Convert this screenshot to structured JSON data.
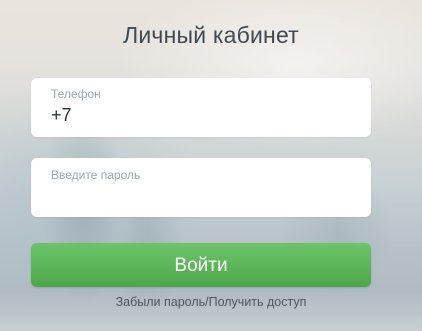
{
  "page": {
    "title": "Личный кабинет"
  },
  "phone_field": {
    "label": "Телефон",
    "value": "+7"
  },
  "password_field": {
    "placeholder": "Введите пароль",
    "value": ""
  },
  "login_button": {
    "label": "Войти",
    "color": "#5bb557"
  },
  "forgot_link": {
    "label": "Забыли пароль/Получить доступ"
  }
}
